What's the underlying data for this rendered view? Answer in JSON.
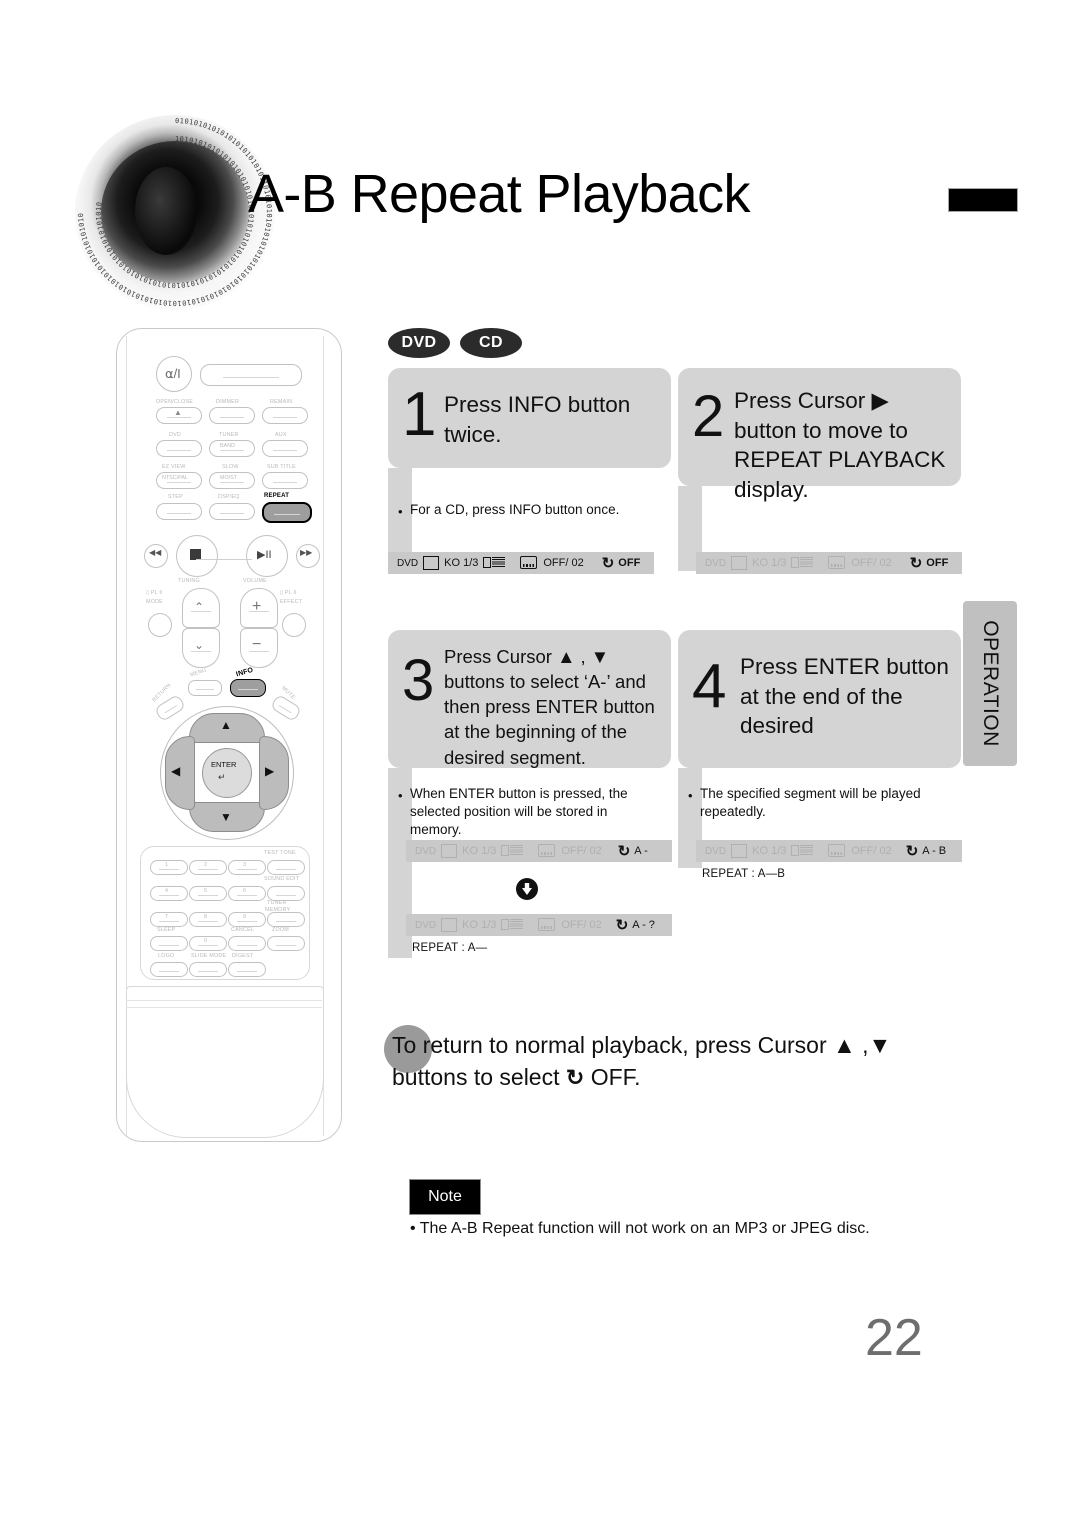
{
  "header": {
    "title": "A-B Repeat Playback",
    "logo_icon": "speaker-logo-icon",
    "rule_icon": "header-rule-mark"
  },
  "disc_badges": [
    {
      "label": "DVD"
    },
    {
      "label": "CD"
    }
  ],
  "side_tab": {
    "label": "OPERATION"
  },
  "steps": [
    {
      "number": "1",
      "heading": "Press INFO button twice.",
      "note": "For a CD, press INFO button once.",
      "osd": [
        {
          "dim": false,
          "source": "DVD",
          "angle_icon": "multi-angle-icon",
          "audio": "KO 1/3",
          "digital_icon": "dolby-digital-icon",
          "subtitle_icon": "subtitle-icon",
          "subtitle": "OFF/ 02",
          "repeat_icon": "repeat-icon",
          "repeat": "OFF"
        }
      ],
      "repeat_label": ""
    },
    {
      "number": "2",
      "heading": "Press Cursor ▶ button to move to REPEAT PLAYBACK display.",
      "note": "",
      "osd": [
        {
          "dim": true,
          "source": "DVD",
          "angle_icon": "multi-angle-icon",
          "audio": "KO 1/3",
          "digital_icon": "dolby-digital-icon",
          "subtitle_icon": "subtitle-icon",
          "subtitle": "OFF/ 02",
          "repeat_icon": "repeat-icon",
          "repeat": "OFF"
        }
      ],
      "repeat_label": ""
    },
    {
      "number": "3",
      "heading": "Press Cursor ▲ , ▼ buttons to select ‘A-’ and then press ENTER button at the beginning of the desired segment.",
      "note": "When ENTER button is pressed, the selected position will be stored in memory.",
      "osd": [
        {
          "dim": true,
          "source": "DVD",
          "angle_icon": "multi-angle-icon",
          "audio": "KO 1/3",
          "digital_icon": "dolby-digital-icon",
          "subtitle_icon": "subtitle-icon",
          "subtitle": "OFF/ 02",
          "repeat_icon": "repeat-icon",
          "repeat": "A -"
        },
        {
          "dim": true,
          "source": "DVD",
          "angle_icon": "multi-angle-icon",
          "audio": "KO 1/3",
          "digital_icon": "dolby-digital-icon",
          "subtitle_icon": "subtitle-icon",
          "subtitle": "OFF/ 02",
          "repeat_icon": "repeat-icon",
          "repeat": "A - ?"
        }
      ],
      "down_arrow_icon": "down-arrow-icon",
      "repeat_label": "REPEAT : A—"
    },
    {
      "number": "4",
      "heading": "Press ENTER button at the end of the desired",
      "note": "The specified segment will be played repeatedly.",
      "osd": [
        {
          "dim": true,
          "source": "DVD",
          "angle_icon": "multi-angle-icon",
          "audio": "KO 1/3",
          "digital_icon": "dolby-digital-icon",
          "subtitle_icon": "subtitle-icon",
          "subtitle": "OFF/ 02",
          "repeat_icon": "repeat-icon",
          "repeat": "A - B"
        }
      ],
      "repeat_label": "REPEAT : A—B"
    }
  ],
  "return_note": {
    "line1": "To return to normal playback, press Cursor ▲ ,▼",
    "line2_pre": "buttons to select",
    "line2_icon": "repeat-icon",
    "line2_post": "OFF."
  },
  "note_section": {
    "badge": "Note",
    "bullet": "• The A-B Repeat function will not work on an MP3 or JPEG disc."
  },
  "page_number": "22",
  "remote": {
    "power_icon": "power-icon",
    "window_label": "",
    "labels_row1": [
      "OPEN/CLOSE",
      "DIMMER",
      "REMAIN"
    ],
    "labels_row2": [
      "DVD",
      "TUNER",
      "AUX"
    ],
    "inner_row2": [
      "",
      "BAND",
      ""
    ],
    "labels_row3": [
      "EZ VIEW",
      "SLOW",
      "SUB TITLE"
    ],
    "inner_row3": [
      "NTSC/PAL",
      "MO/ST",
      ""
    ],
    "labels_row4": [
      "STEP",
      "DSP/EQ",
      "REPEAT"
    ],
    "transport": [
      "prev-icon",
      "stop-icon",
      "play-pause-icon",
      "next-icon"
    ],
    "tuning_label": "TUNING",
    "volume_label": "VOLUME",
    "plii_mode": "PL II\nMODE",
    "plii_effect": "PL II\nEFFECT",
    "menu_label": "MENU",
    "info_label": "INFO",
    "return_label": "RETURN",
    "mute_label": "MUTE",
    "enter_label": "ENTER",
    "keypad": [
      [
        "1",
        "2",
        "3",
        ""
      ],
      [
        "4",
        "5",
        "6",
        ""
      ],
      [
        "7",
        "8",
        "9",
        ""
      ],
      [
        "",
        "0",
        "",
        ""
      ],
      [
        "",
        "",
        "",
        ""
      ]
    ],
    "keypad_labels": {
      "test_tone": "TEST TONE",
      "sound_edit": "SOUND EDIT",
      "tuner_memory": "TUNER MEMORY",
      "sleep": "SLEEP",
      "cancel": "CANCEL",
      "zoom": "ZOOM",
      "logo": "LOGO",
      "slide_mode": "SLIDE MODE",
      "digest": "DIGEST"
    }
  },
  "colors": {
    "box_gray": "#d4d4d4",
    "osd_gray": "#c9c9c9",
    "tab_gray": "#c0c0c0",
    "badge_black": "#2b2b2b",
    "page_number_gray": "#6e6e6e"
  }
}
